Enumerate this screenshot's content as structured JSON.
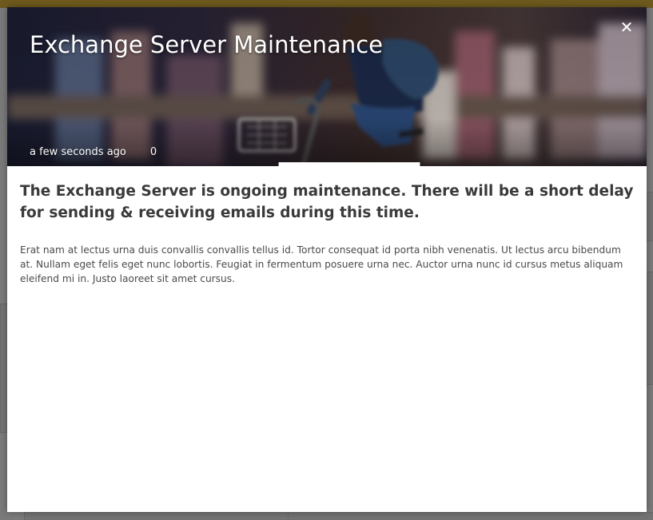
{
  "modal": {
    "title": "Exchange Server Maintenance",
    "close_label": "✕",
    "timestamp": "a few seconds ago",
    "comment_count": "0",
    "headline": "The Exchange Server is ongoing maintenance. There will be a short delay for sending & receiving emails during this time.",
    "body": "Erat nam at lectus urna duis convallis convallis tellus id. Tortor consequat id porta nibh venenatis. Ut lectus arcu bibendum at. Nullam eget felis eget nunc lobortis. Feugiat in fermentum posuere urna nec. Auctor urna nunc id cursus metus aliquam eleifend mi in. Justo laoreet sit amet cursus."
  },
  "icons": {
    "close": "close-icon",
    "comment": "comment-icon"
  },
  "colors": {
    "overlay": "#7a7a7a",
    "header_strip": "#6e5a1e",
    "modal_background": "#ffffff",
    "headline_text": "#3a3a3a",
    "body_text": "#4a4a4a"
  }
}
